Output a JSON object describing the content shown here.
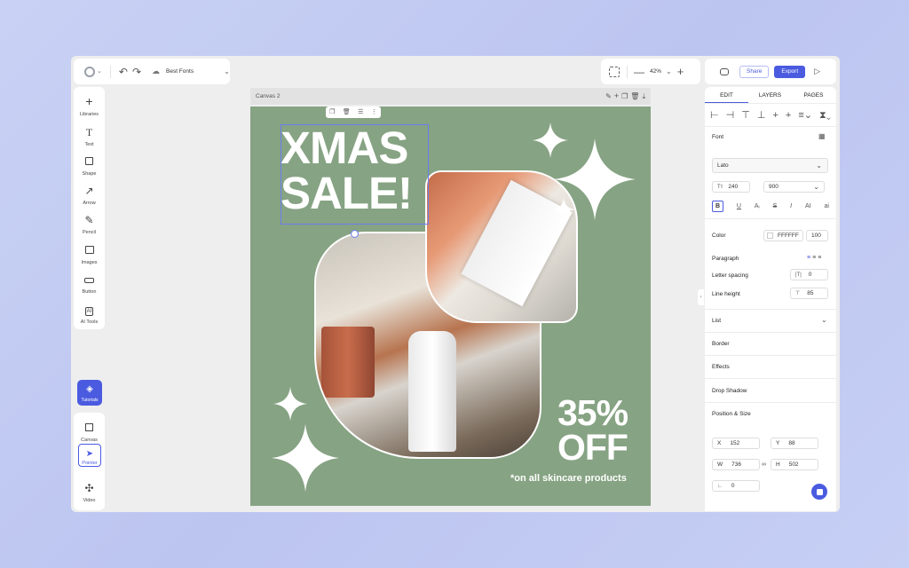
{
  "topbar": {
    "logo_letter": "G",
    "doc_name": "Best Fonts",
    "zoom": "42%",
    "share_label": "Share",
    "export_label": "Export"
  },
  "tools": [
    {
      "label": "Libraries",
      "icon": "plus-icon"
    },
    {
      "label": "Text",
      "icon": "text-icon"
    },
    {
      "label": "Shape",
      "icon": "square-icon"
    },
    {
      "label": "Arrow",
      "icon": "arrow-icon"
    },
    {
      "label": "Pencil",
      "icon": "pencil-icon"
    },
    {
      "label": "Images",
      "icon": "image-icon"
    },
    {
      "label": "Button",
      "icon": "button-icon"
    },
    {
      "label": "AI Tools",
      "icon": "ai-icon"
    }
  ],
  "tutorials_label": "Tutorials",
  "bottomtools": [
    {
      "label": "Canvas",
      "icon": "canvas-icon"
    },
    {
      "label": "Pointer",
      "icon": "pointer-icon"
    },
    {
      "label": "Video",
      "icon": "video-icon"
    }
  ],
  "canvas": {
    "name": "Canvas 2",
    "headline1": "XMAS",
    "headline2": "SALE!",
    "discount1": "35%",
    "discount2": "OFF",
    "footnote": "*on all skincare products",
    "bg_color": "#86a383"
  },
  "panel": {
    "tabs": [
      "EDIT",
      "LAYERS",
      "PAGES"
    ],
    "active_tab": "EDIT",
    "font_label": "Font",
    "font_name": "Lato",
    "font_size": "240",
    "font_weight": "900",
    "style_btns": [
      "B",
      "U",
      "Aᵢ",
      "S",
      "I",
      "AI",
      "ai"
    ],
    "color_label": "Color",
    "color_hex": "FFFFFF",
    "opacity": "100",
    "paragraph_label": "Paragraph",
    "letter_spacing_label": "Letter spacing",
    "letter_spacing": "0",
    "line_height_label": "Line height",
    "line_height": "85",
    "list_label": "List",
    "border_label": "Border",
    "effects_label": "Effects",
    "drop_shadow_label": "Drop Shadow",
    "pos_size_label": "Position & Size",
    "x_label": "X",
    "x": "152",
    "y_label": "Y",
    "y": "88",
    "w_label": "W",
    "w": "736",
    "h_label": "H",
    "h": "502",
    "rotation": "0"
  },
  "colors": {
    "accent": "#4a5be0",
    "canvas_bg": "#86a383"
  }
}
